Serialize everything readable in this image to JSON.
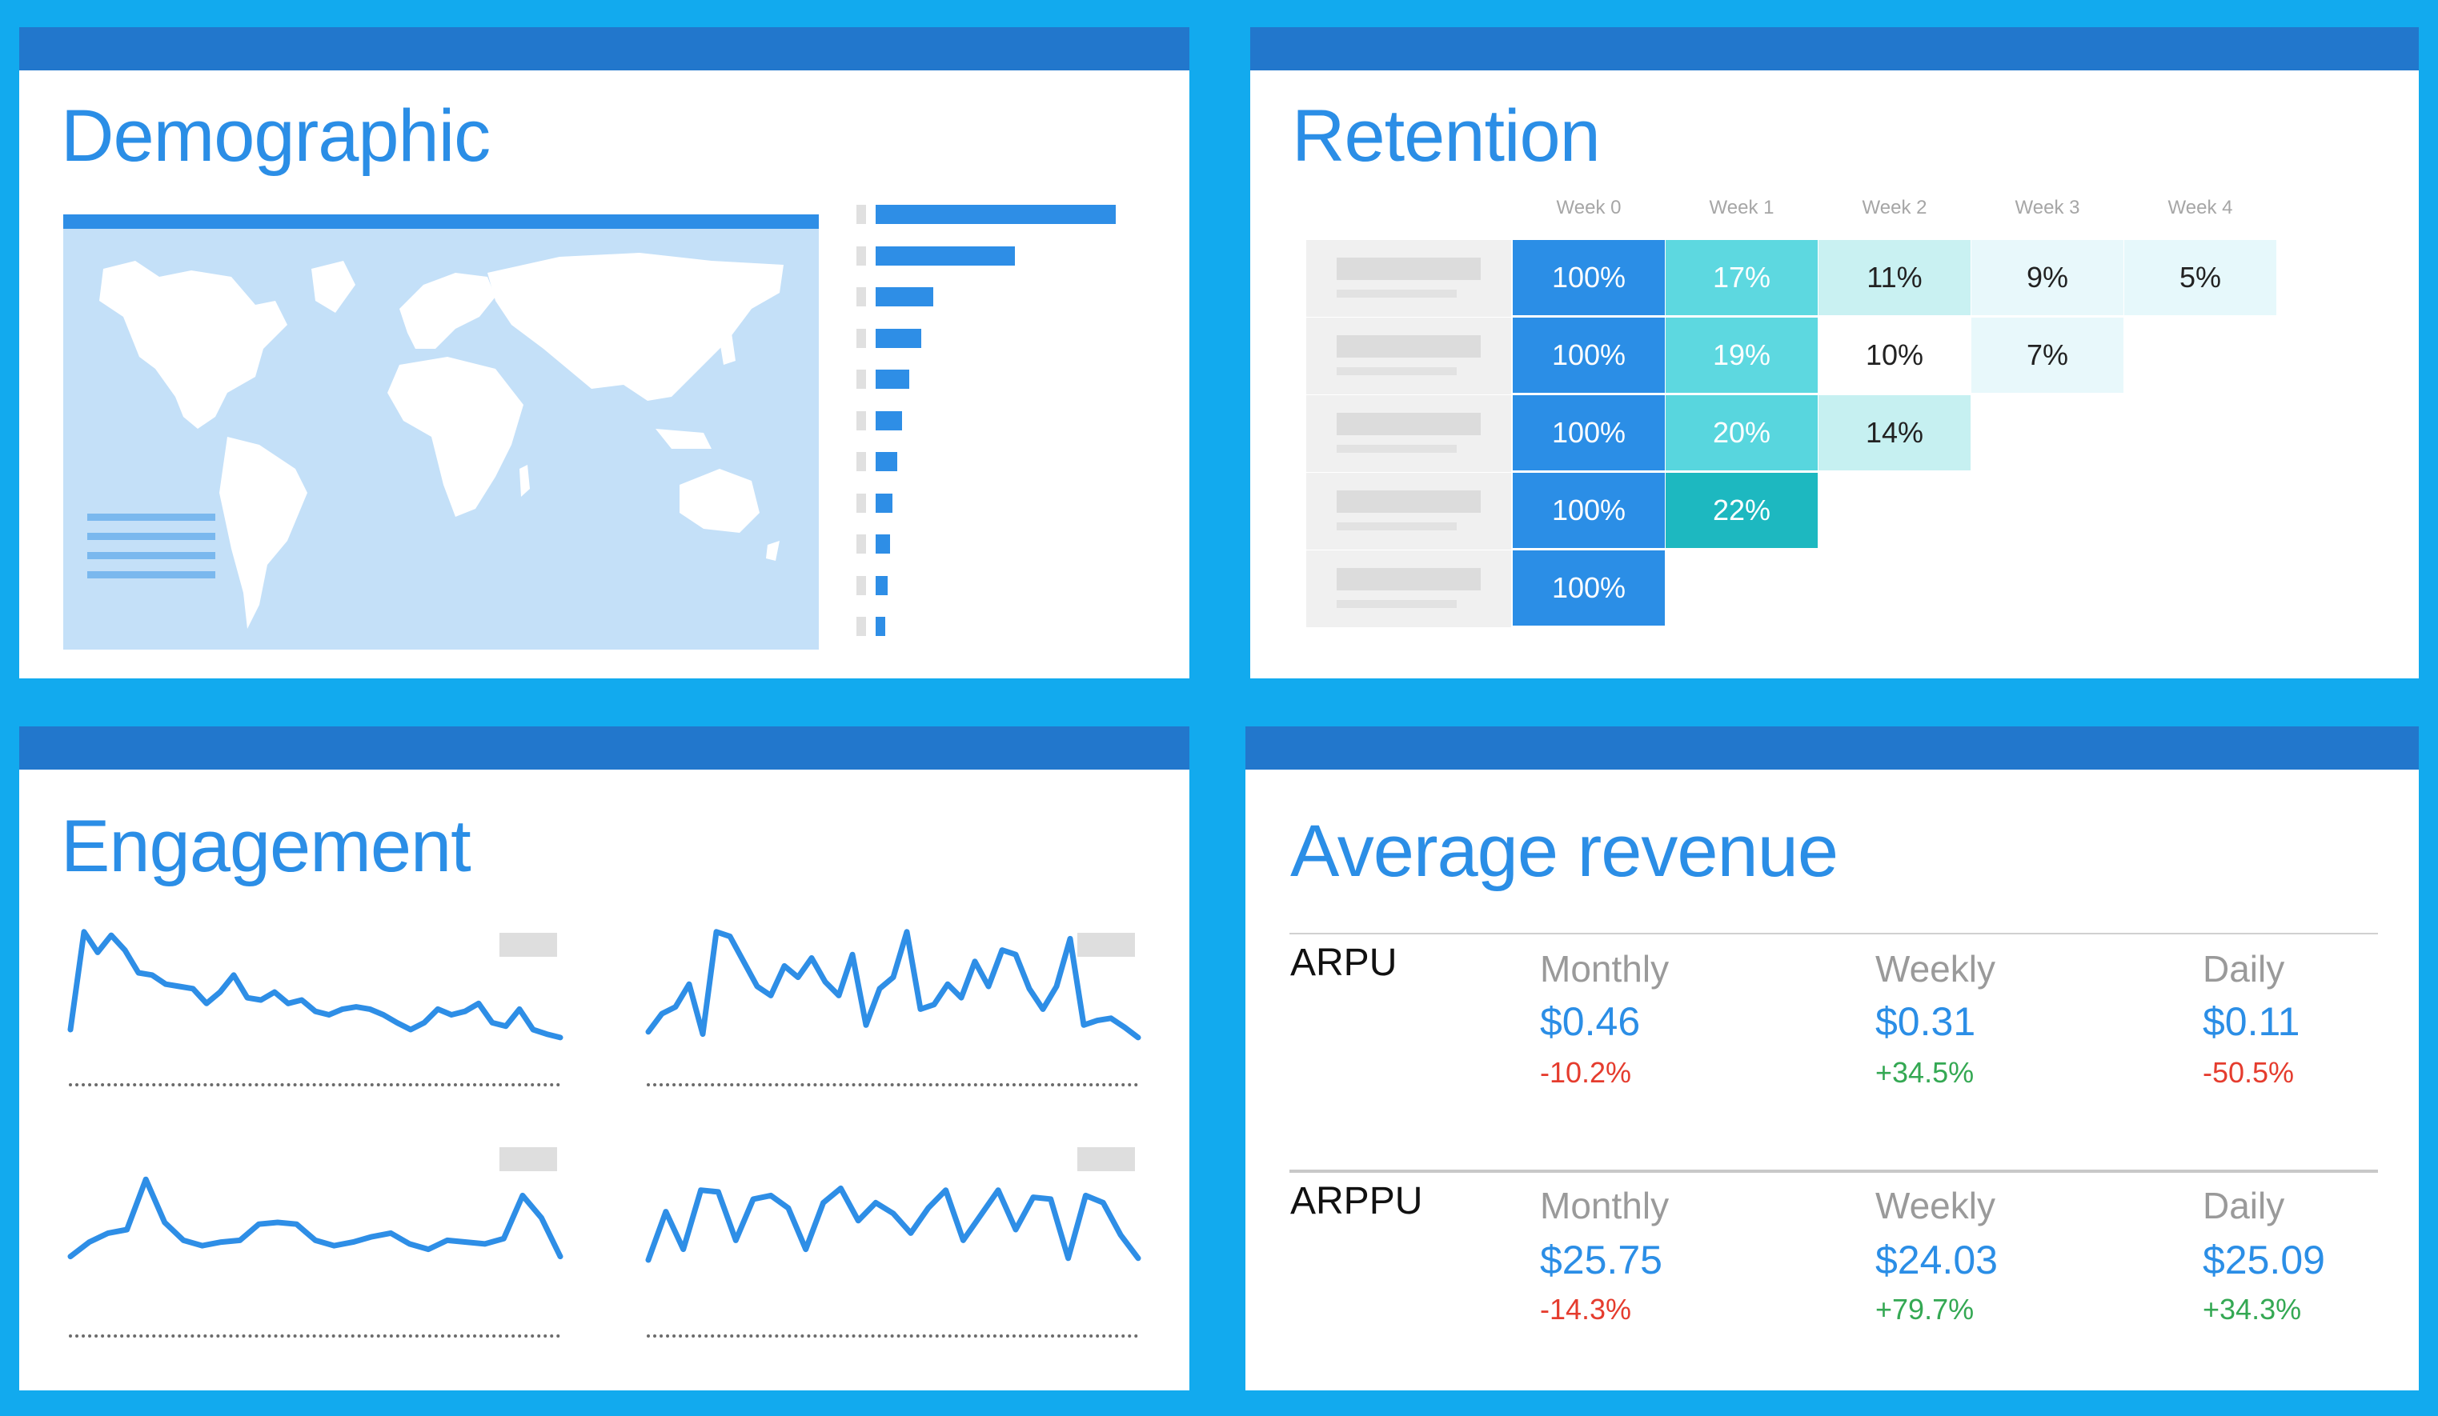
{
  "demographic": {
    "title": "Demographic",
    "bar_fractions": [
      1.0,
      0.58,
      0.24,
      0.19,
      0.14,
      0.11,
      0.09,
      0.07,
      0.06,
      0.05,
      0.04
    ]
  },
  "retention": {
    "title": "Retention",
    "weeks": [
      "Week 0",
      "Week 1",
      "Week 2",
      "Week 3",
      "Week 4"
    ],
    "rows": [
      [
        "100%",
        "17%",
        "11%",
        "9%",
        "5%"
      ],
      [
        "100%",
        "19%",
        "10%",
        "7%"
      ],
      [
        "100%",
        "20%",
        "14%"
      ],
      [
        "100%",
        "22%"
      ],
      [
        "100%"
      ]
    ],
    "colors": {
      "w0": "#2b8ee6",
      "w1": [
        "#5dd8e0",
        "#5dd8e0",
        "#58d6de",
        "#1db8c0"
      ],
      "w2": [
        "#c9f1f2",
        "#ffffff",
        "#c6f0f1"
      ],
      "w3": [
        "#e8f8fb",
        "#e8f8fb"
      ],
      "w4": [
        "#e6f8fb"
      ]
    }
  },
  "engagement": {
    "title": "Engagement",
    "sparklines": [
      [
        12,
        98,
        80,
        95,
        82,
        62,
        60,
        52,
        50,
        48,
        35,
        45,
        60,
        40,
        38,
        45,
        35,
        38,
        28,
        25,
        30,
        32,
        30,
        25,
        18,
        12,
        18,
        30,
        25,
        28,
        35,
        18,
        15,
        30,
        12,
        8,
        5
      ],
      [
        10,
        26,
        32,
        52,
        8,
        98,
        94,
        72,
        50,
        42,
        68,
        58,
        75,
        54,
        42,
        78,
        16,
        48,
        58,
        98,
        30,
        34,
        52,
        40,
        72,
        50,
        82,
        78,
        48,
        30,
        50,
        92,
        16,
        20,
        22,
        14,
        5
      ],
      [
        12,
        28,
        38,
        42,
        98,
        50,
        30,
        24,
        28,
        30,
        48,
        50,
        48,
        30,
        24,
        28,
        34,
        38,
        26,
        20,
        30,
        28,
        26,
        32,
        80,
        55,
        12
      ],
      [
        8,
        62,
        20,
        86,
        84,
        30,
        76,
        80,
        66,
        20,
        72,
        88,
        52,
        72,
        60,
        38,
        66,
        86,
        30,
        58,
        86,
        42,
        78,
        76,
        10,
        80,
        72,
        36,
        10
      ]
    ]
  },
  "revenue": {
    "title": "Average revenue",
    "blocks": [
      {
        "name": "ARPU",
        "items": [
          {
            "period": "Monthly",
            "value": "$0.46",
            "change": "-10.2%",
            "dir": "neg"
          },
          {
            "period": "Weekly",
            "value": "$0.31",
            "change": "+34.5%",
            "dir": "pos"
          },
          {
            "period": "Daily",
            "value": "$0.11",
            "change": "-50.5%",
            "dir": "neg"
          }
        ]
      },
      {
        "name": "ARPPU",
        "items": [
          {
            "period": "Monthly",
            "value": "$25.75",
            "change": "-14.3%",
            "dir": "neg"
          },
          {
            "period": "Weekly",
            "value": "$24.03",
            "change": "+79.7%",
            "dir": "pos"
          },
          {
            "period": "Daily",
            "value": "$25.09",
            "change": "+34.3%",
            "dir": "pos"
          }
        ]
      }
    ]
  }
}
